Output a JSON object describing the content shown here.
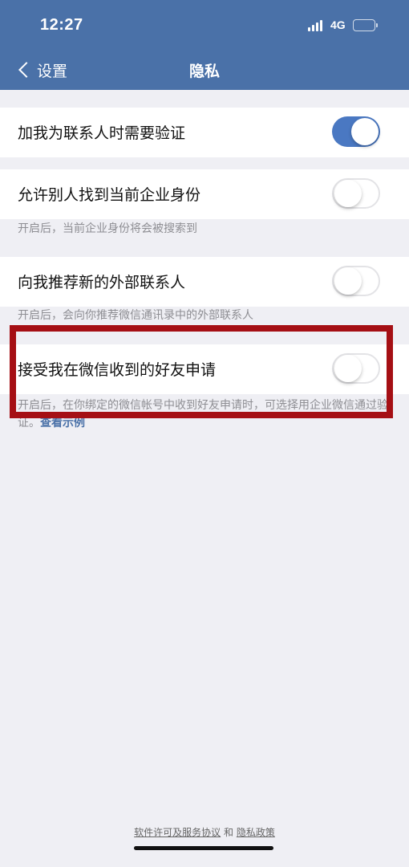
{
  "status_bar": {
    "time": "12:27",
    "network": "4G"
  },
  "nav": {
    "back_label": "设置",
    "title": "隐私"
  },
  "settings": [
    {
      "label": "加我为联系人时需要验证",
      "enabled": true
    },
    {
      "label": "允许别人找到当前企业身份",
      "enabled": false,
      "description": "开启后，当前企业身份将会被搜索到"
    },
    {
      "label": "向我推荐新的外部联系人",
      "enabled": false,
      "description": "开启后，会向你推荐微信通讯录中的外部联系人"
    },
    {
      "label": "接受我在微信收到的好友申请",
      "enabled": false,
      "description": "开启后，在你绑定的微信帐号中收到好友申请时，可选择用企业微信通过验证。",
      "link": "查看示例"
    }
  ],
  "footer": {
    "license_link": "软件许可及服务协议",
    "and": "和",
    "privacy_link": "隐私政策"
  },
  "colors": {
    "nav_bg": "#4a71a8",
    "toggle_on": "#4a78c2",
    "highlight": "#a50f14",
    "battery": "#f5d327"
  }
}
